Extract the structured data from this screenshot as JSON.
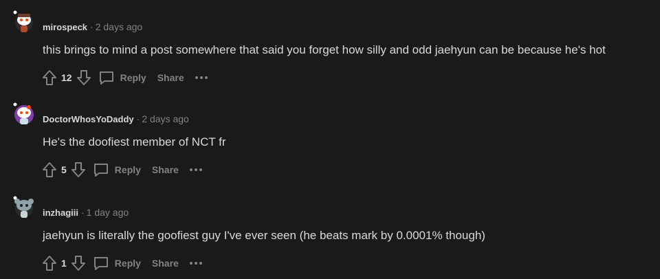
{
  "comments": [
    {
      "username": "mirospeck",
      "separator": "·",
      "time": "2 days ago",
      "body": "this brings to mind a post somewhere that said you forget how silly and odd jaehyun can be because he's hot",
      "score": "12",
      "reply_label": "Reply",
      "share_label": "Share",
      "avatar_color": "#ffffff",
      "avatar_accent": "#6b3e2e"
    },
    {
      "username": "DoctorWhosYoDaddy",
      "separator": "·",
      "time": "2 days ago",
      "body": "He's the doofiest member of NCT fr",
      "score": "5",
      "reply_label": "Reply",
      "share_label": "Share",
      "avatar_color": "#7e3fa8",
      "avatar_accent": "#ff4500"
    },
    {
      "username": "inzhagiii",
      "separator": "·",
      "time": "1 day ago",
      "body": "jaehyun is literally the goofiest guy I've ever seen (he beats mark by 0.0001% though)",
      "score": "1",
      "reply_label": "Reply",
      "share_label": "Share",
      "avatar_color": "#8fa3a8",
      "avatar_accent": "#c9d4d6"
    }
  ],
  "colors": {
    "background": "#1a1a1b",
    "text": "#d7dadc",
    "muted": "#818384"
  }
}
